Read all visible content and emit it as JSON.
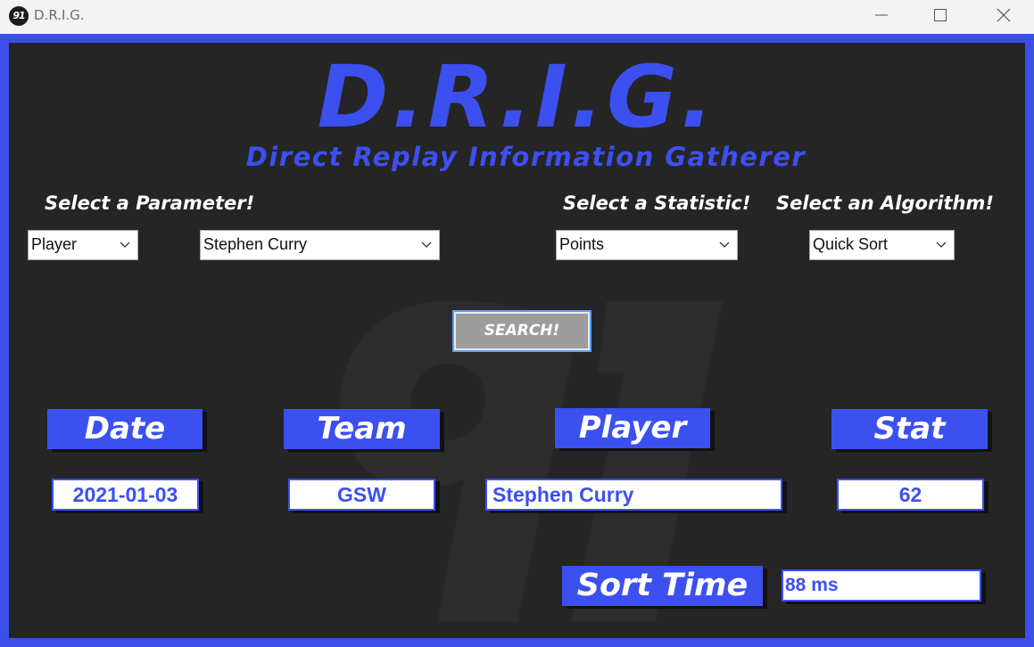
{
  "window": {
    "title": "D.R.I.G.",
    "icon_text": "91"
  },
  "logo": {
    "main": "D.R.I.G.",
    "subtitle": "Direct Replay Information Gatherer"
  },
  "prompts": {
    "parameter": "Select a Parameter!",
    "statistic": "Select a Statistic!",
    "algorithm": "Select an Algorithm!"
  },
  "selects": {
    "parameter_type": "Player",
    "parameter_value": "Stephen Curry",
    "statistic": "Points",
    "algorithm": "Quick Sort"
  },
  "search_button": "SEARCH!",
  "headers": {
    "date": "Date",
    "team": "Team",
    "player": "Player",
    "stat": "Stat",
    "sort_time": "Sort Time"
  },
  "results": {
    "date": "2021-01-03",
    "team": "GSW",
    "player": "Stephen Curry",
    "stat": "62",
    "sort_time": "88 ms"
  },
  "colors": {
    "accent": "#3c50f0",
    "panel": "#252525",
    "button": "#9d9d9d"
  }
}
